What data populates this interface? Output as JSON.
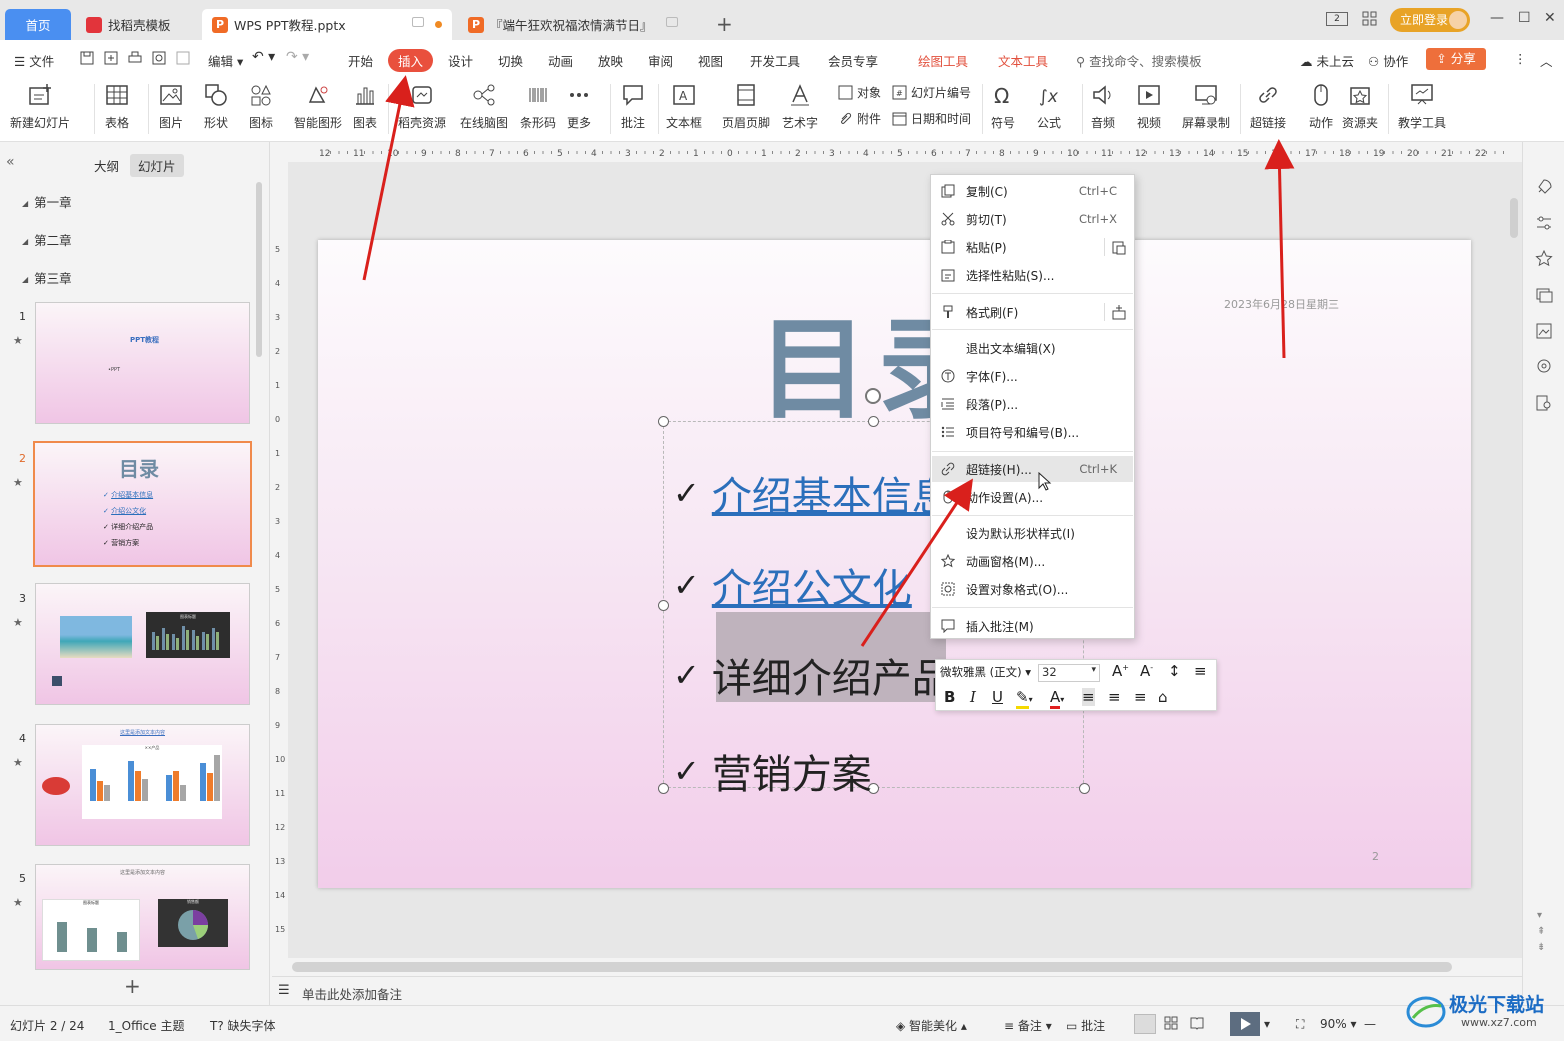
{
  "titlebar": {
    "tabs": [
      {
        "label": "首页"
      },
      {
        "label": "找稻壳模板"
      },
      {
        "label": "WPS PPT教程.pptx"
      },
      {
        "label": "『端午狂欢祝福浓情满节日』"
      }
    ],
    "login": "立即登录",
    "view_badge": "2"
  },
  "menubar": {
    "file": "文件",
    "edit": "编辑",
    "tabs": [
      "开始",
      "插入",
      "设计",
      "切换",
      "动画",
      "放映",
      "审阅",
      "视图",
      "开发工具",
      "会员专享"
    ],
    "active_tab": "插入",
    "context_tabs": [
      "绘图工具",
      "文本工具"
    ],
    "search": "查找命令、搜索模板",
    "cloud": "未上云",
    "collab": "协作",
    "share": "分享"
  },
  "ribbon": {
    "new_slide": "新建幻灯片",
    "table": "表格",
    "picture": "图片",
    "shape": "形状",
    "icon": "图标",
    "smart": "智能图形",
    "chart": "图表",
    "resource": "稻壳资源",
    "mindmap": "在线脑图",
    "barcode": "条形码",
    "more": "更多",
    "comment": "批注",
    "textbox": "文本框",
    "header": "页眉页脚",
    "wordart": "艺术字",
    "object": "对象",
    "attach": "附件",
    "slide_no": "幻灯片编号",
    "datetime": "日期和时间",
    "symbol": "符号",
    "formula": "公式",
    "audio": "音频",
    "video": "视频",
    "record": "屏幕录制",
    "hyperlink": "超链接",
    "action": "动作",
    "resfolder": "资源夹",
    "teach": "教学工具"
  },
  "leftpanel": {
    "tab_outline": "大纲",
    "tab_slides": "幻灯片",
    "sections": [
      "第一章",
      "第二章",
      "第三章"
    ],
    "slides": [
      {
        "num": "1",
        "title": "PPT教程",
        "sub": "•PPT"
      },
      {
        "num": "2",
        "title": "目录",
        "items": [
          "介绍基本信息",
          "介绍公文化",
          "详细介绍产品",
          "营销方案"
        ]
      },
      {
        "num": "3",
        "chart_title": "图表标题"
      },
      {
        "num": "4",
        "title": "这里是添加文本内容",
        "chart_title": "××产品"
      },
      {
        "num": "5",
        "title": "这里是添加文本内容",
        "chart_a": "图表标题",
        "chart_b": "销售额"
      }
    ]
  },
  "slide": {
    "title": "目录",
    "date": "2023年6月28日星期三",
    "page": "2",
    "items": [
      "介绍基本信息",
      "介绍公文化",
      "详细介绍产品",
      "营销方案"
    ],
    "check": "✓"
  },
  "context_menu": {
    "items": [
      {
        "label": "复制(C)",
        "shortcut": "Ctrl+C"
      },
      {
        "label": "剪切(T)",
        "shortcut": "Ctrl+X"
      },
      {
        "label": "粘贴(P)",
        "shortcut": ""
      },
      {
        "label": "选择性粘贴(S)...",
        "shortcut": ""
      },
      {
        "label": "格式刷(F)",
        "shortcut": ""
      },
      {
        "label": "退出文本编辑(X)",
        "shortcut": ""
      },
      {
        "label": "字体(F)...",
        "shortcut": ""
      },
      {
        "label": "段落(P)...",
        "shortcut": ""
      },
      {
        "label": "项目符号和编号(B)...",
        "shortcut": ""
      },
      {
        "label": "超链接(H)...",
        "shortcut": "Ctrl+K"
      },
      {
        "label": "动作设置(A)...",
        "shortcut": ""
      },
      {
        "label": "设为默认形状样式(I)",
        "shortcut": ""
      },
      {
        "label": "动画窗格(M)...",
        "shortcut": ""
      },
      {
        "label": "设置对象格式(O)...",
        "shortcut": ""
      },
      {
        "label": "插入批注(M)",
        "shortcut": ""
      }
    ],
    "highlighted": "超链接(H)..."
  },
  "mini_toolbar": {
    "font": "微软雅黑 (正文)",
    "size": "32",
    "bold": "B",
    "italic": "I",
    "underline": "U"
  },
  "notes": {
    "placeholder": "单击此处添加备注"
  },
  "statusbar": {
    "slide_info": "幻灯片 2 / 24",
    "theme": "1_Office 主题",
    "missing_font": "缺失字体",
    "beautify": "智能美化",
    "notes": "备注",
    "comment": "批注",
    "zoom": "90%"
  },
  "watermark": {
    "text": "极光下载站",
    "url": "www.xz7.com"
  },
  "colors": {
    "accent": "#e9503d",
    "link": "#2b6fbb",
    "title": "#6f8ba3",
    "arrow": "#d9201c"
  }
}
